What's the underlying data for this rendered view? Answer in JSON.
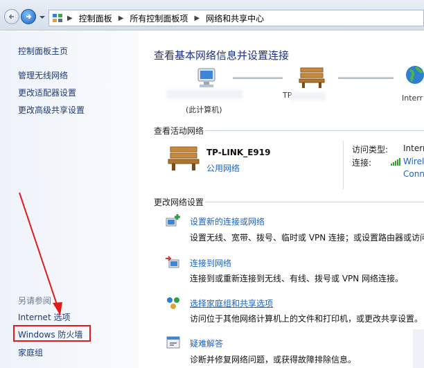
{
  "breadcrumb": [
    "控制面板",
    "所有控制面板项",
    "网络和共享中心"
  ],
  "left_pane": {
    "home": "控制面板主页",
    "links": [
      "管理无线网络",
      "更改适配器设置",
      "更改高级共享设置"
    ],
    "see_also_label": "另请参阅",
    "see_also": [
      "Internet 选项",
      "Windows 防火墙",
      "家庭组"
    ]
  },
  "main": {
    "title": "查看基本网络信息并设置连接",
    "map": {
      "this_pc_label": "(此计算机)",
      "router_label": "TP",
      "internet_label": "Interr"
    },
    "active_section": "查看活动网络",
    "active_network": {
      "name": "TP-LINK_E919",
      "category": "公用网络",
      "access_type_label": "访问类型:",
      "access_type_value": "Interr",
      "connection_label": "连接:",
      "connection_value_line1": "Wirel",
      "connection_value_line2": "Conn"
    },
    "change_section": "更改网络设置",
    "tasks": [
      {
        "title": "设置新的连接或网络",
        "desc": "设置无线、宽带、拨号、临时或 VPN 连接；或设置路由器或访问"
      },
      {
        "title": "连接到网络",
        "desc": "连接到或重新连接到无线、有线、拨号或 VPN 网络连接。"
      },
      {
        "title": "选择家庭组和共享选项",
        "desc": "访问位于其他网络计算机上的文件和打印机，或更改共享设置。"
      },
      {
        "title": "疑难解答",
        "desc": "诊断并修复网络问题，或获得故障排除信息。"
      }
    ]
  },
  "colors": {
    "link": "#1f63c3",
    "title": "#1e3287",
    "highlight_box": "#e01b1b"
  }
}
